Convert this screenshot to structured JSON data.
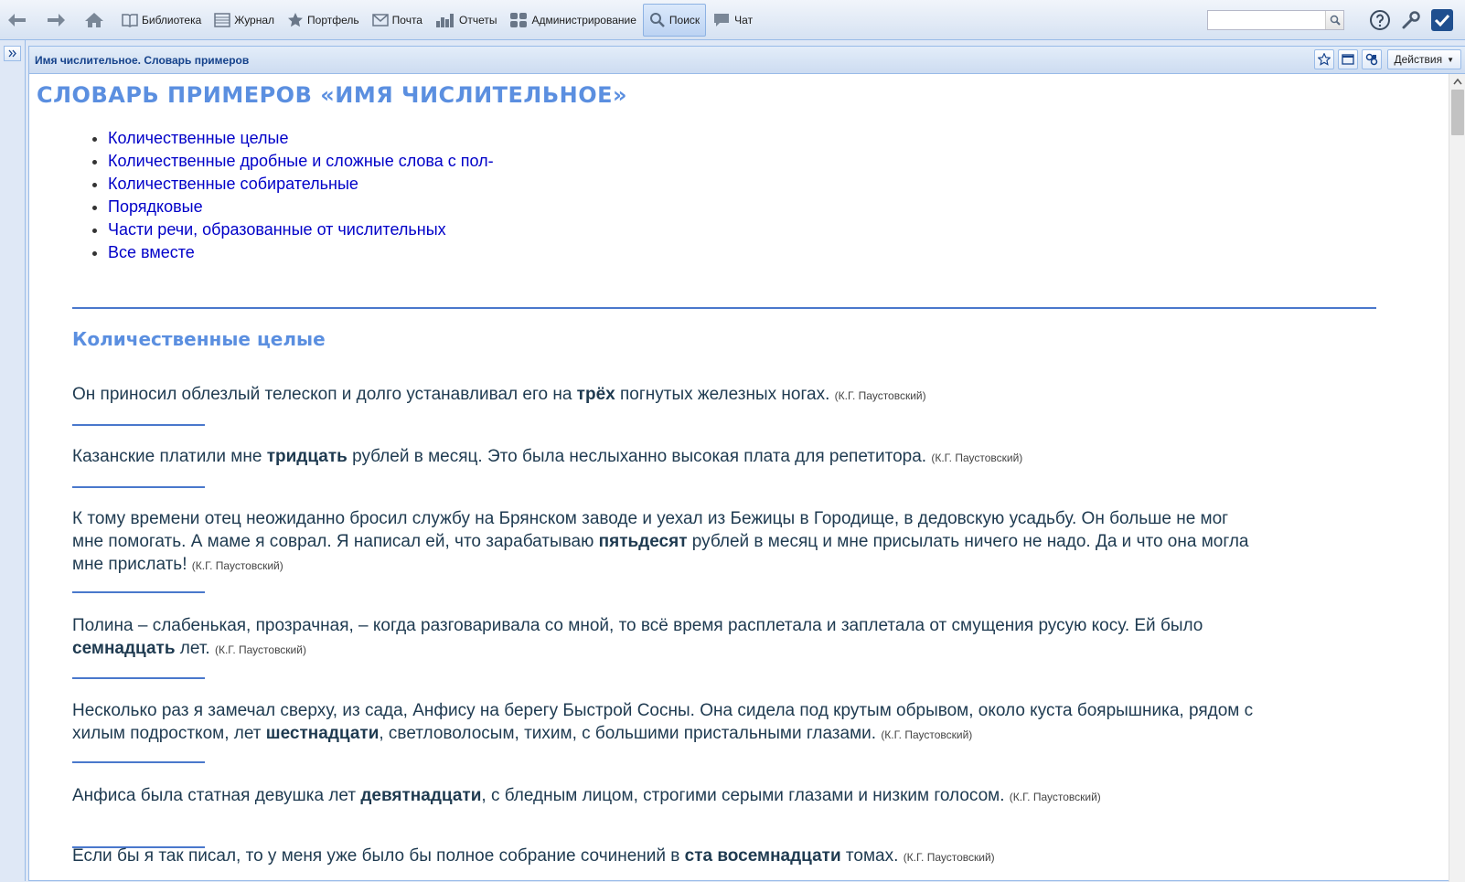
{
  "toolbar": {
    "items": [
      {
        "label": "Библиотека",
        "icon": "book-icon"
      },
      {
        "label": "Журнал",
        "icon": "journal-icon"
      },
      {
        "label": "Портфель",
        "icon": "star-icon"
      },
      {
        "label": "Почта",
        "icon": "mail-icon"
      },
      {
        "label": "Отчеты",
        "icon": "chart-icon"
      },
      {
        "label": "Администрирование",
        "icon": "admin-icon"
      },
      {
        "label": "Поиск",
        "icon": "search-icon",
        "active": true
      },
      {
        "label": "Чат",
        "icon": "chat-icon"
      }
    ],
    "search": {
      "value": "",
      "placeholder": ""
    }
  },
  "panel": {
    "title": "Имя числительное. Словарь примеров",
    "actions_label": "Действия"
  },
  "page": {
    "title": "СЛОВАРЬ ПРИМЕРОВ «ИМЯ ЧИСЛИТЕЛЬНОЕ»",
    "toc": [
      "Количественные целые",
      "Количественные дробные и сложные слова с пол-",
      "Количественные собирательные",
      "Порядковые",
      "Части речи, образованные от числительных",
      "Все вместе"
    ],
    "section_title": "Количественные целые",
    "examples": [
      {
        "lines": [
          [
            {
              "t": "Он приносил облезлый телескоп и долго устанавливал его на "
            },
            {
              "t": "трёх",
              "b": true
            },
            {
              "t": " погнутых железных ногах. "
            }
          ]
        ],
        "source": "(К.Г. Паустовский)"
      },
      {
        "lines": [
          [
            {
              "t": "Казанские платили мне "
            },
            {
              "t": "тридцать",
              "b": true
            },
            {
              "t": " рублей в месяц. Это была неслыханно высокая плата для репетитора. "
            }
          ]
        ],
        "source": "(К.Г. Паустовский)"
      },
      {
        "lines": [
          [
            {
              "t": "К тому времени отец неожиданно бросил службу на Брянском заводе и уехал из Бежицы в Городище, в дедовскую усадьбу. Он больше не мог"
            }
          ],
          [
            {
              "t": "мне помогать. А маме я соврал. Я написал ей, что зарабатываю "
            },
            {
              "t": "пятьдесят",
              "b": true
            },
            {
              "t": " рублей в месяц и мне присылать ничего не надо. Да и что она могла"
            }
          ],
          [
            {
              "t": "мне прислать! "
            }
          ]
        ],
        "source": "(К.Г. Паустовский)"
      },
      {
        "lines": [
          [
            {
              "t": "Полина – слабенькая, прозрачная, – когда разговаривала со мной, то всё время расплетала и заплетала от смущения русую косу. Ей было"
            }
          ],
          [
            {
              "t": "семнадцать",
              "b": true
            },
            {
              "t": " лет. "
            }
          ]
        ],
        "source": "(К.Г. Паустовский)"
      },
      {
        "lines": [
          [
            {
              "t": "Несколько раз я замечал сверху, из сада, Анфису на берегу Быстрой Сосны. Она сидела под крутым обрывом, около куста боярышника, рядом с"
            }
          ],
          [
            {
              "t": "хилым подростком, лет "
            },
            {
              "t": "шестнадцати",
              "b": true
            },
            {
              "t": ", светловолосым, тихим, с большими пристальными глазами. "
            }
          ]
        ],
        "source": "(К.Г. Паустовский)"
      },
      {
        "lines": [
          [
            {
              "t": "Анфиса была статная девушка лет "
            },
            {
              "t": "девятнадцати",
              "b": true
            },
            {
              "t": ", с бледным лицом, строгими серыми глазами и низким голосом. "
            }
          ]
        ],
        "source": "(К.Г. Паустовский)"
      },
      {
        "lines": [
          [
            {
              "t": "Если бы я так писал, то у меня уже было бы полное собрание сочинений в "
            },
            {
              "t": "ста восемнадцати",
              "b": true
            },
            {
              "t": " томах. "
            }
          ]
        ],
        "source": "(К.Г. Паустовский)"
      }
    ]
  }
}
